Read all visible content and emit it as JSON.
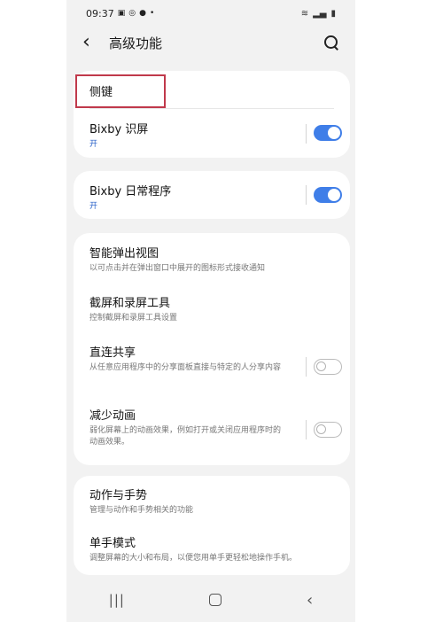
{
  "status_bar": {
    "time": "09:37"
  },
  "header": {
    "title": "高级功能"
  },
  "items": {
    "side_key": {
      "title": "侧键"
    },
    "bixby_vision": {
      "title": "Bixby 识屏",
      "status": "开",
      "toggle": "on"
    },
    "bixby_routines": {
      "title": "Bixby 日常程序",
      "status": "开",
      "toggle": "on"
    },
    "smart_popup": {
      "title": "智能弹出视图",
      "desc": "以可点击并在弹出窗口中展开的图标形式接收通知"
    },
    "screenshot_tools": {
      "title": "截屏和录屏工具",
      "desc": "控制截屏和录屏工具设置"
    },
    "direct_share": {
      "title": "直连共享",
      "desc": "从任意应用程序中的分享面板直接与特定的人分享内容",
      "toggle": "off"
    },
    "reduce_animations": {
      "title": "减少动画",
      "desc": "弱化屏幕上的动画效果，例如打开或关闭应用程序时的动画效果。",
      "toggle": "off"
    },
    "motions_gestures": {
      "title": "动作与手势",
      "desc": "管理与动作和手势相关的功能"
    },
    "one_hand_mode": {
      "title": "单手模式",
      "desc": "调整屏幕的大小和布局，以便您用单手更轻松地操作手机。"
    }
  },
  "colors": {
    "accent": "#3f7ee8",
    "status_on": "#2860c8",
    "highlight": "#c0394b"
  }
}
